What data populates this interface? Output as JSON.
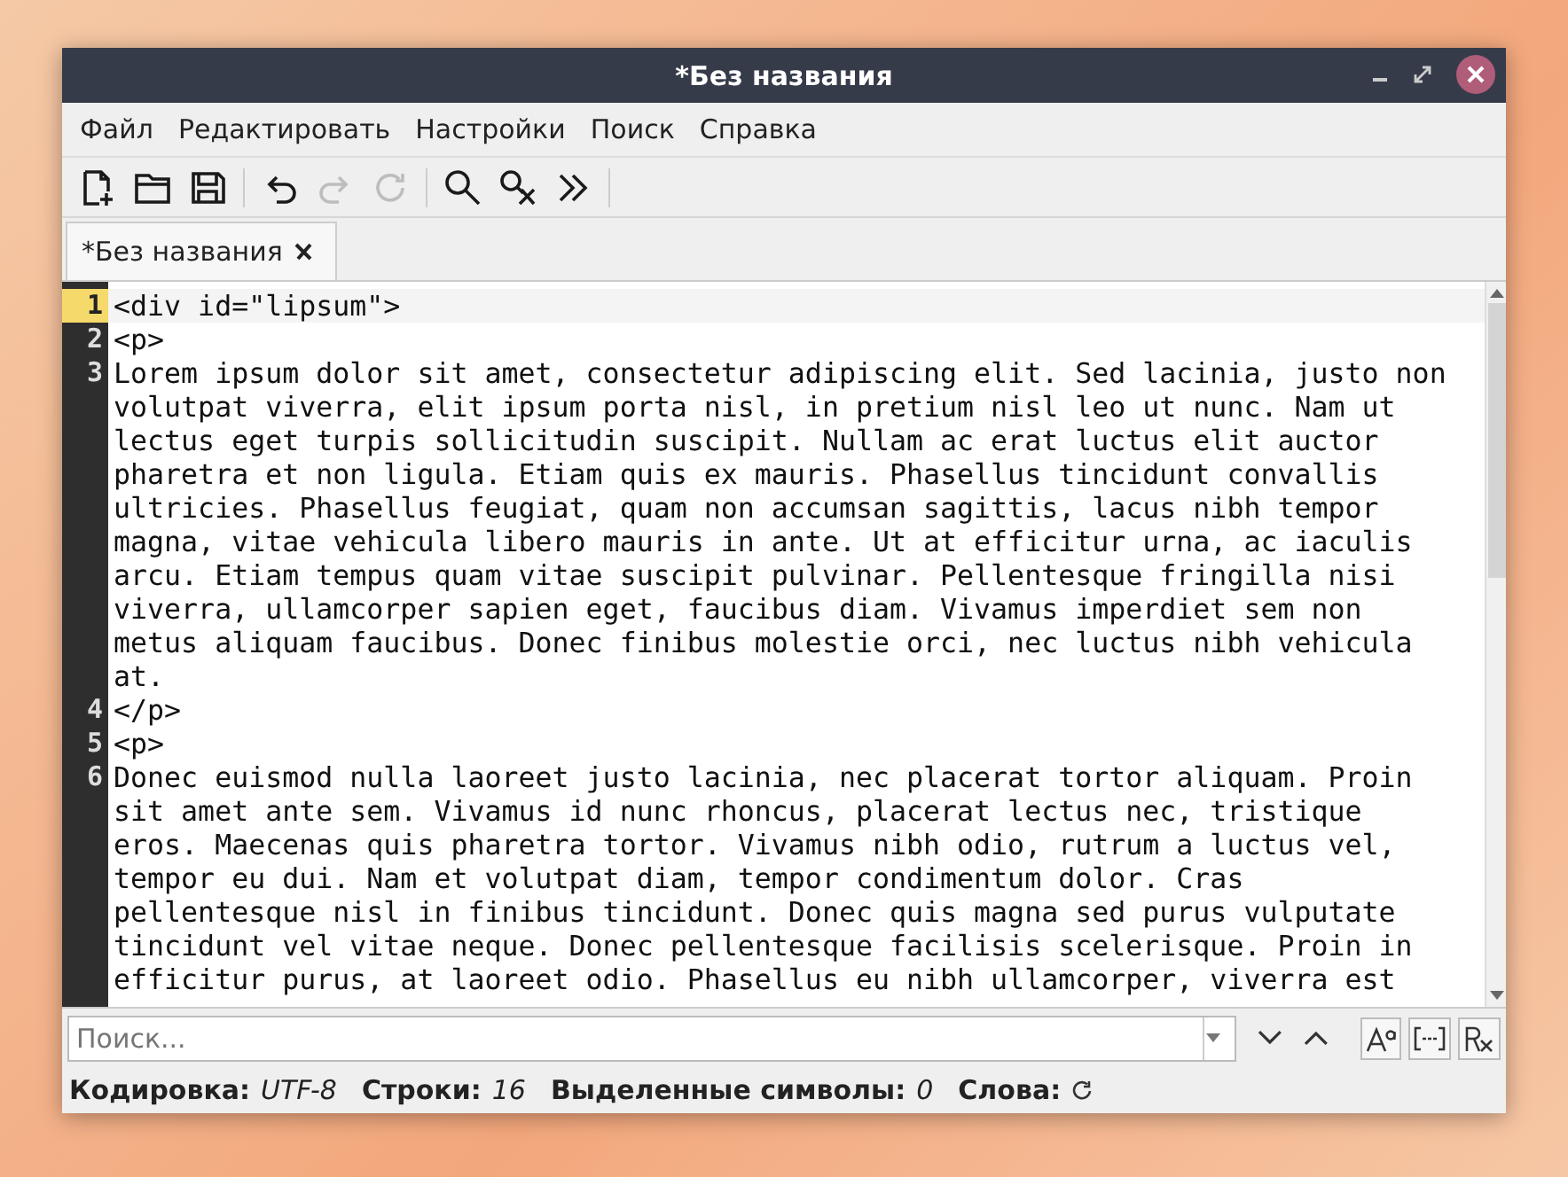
{
  "window": {
    "title": "*Без названия"
  },
  "menu": [
    "Файл",
    "Редактировать",
    "Настройки",
    "Поиск",
    "Справка"
  ],
  "toolbar": [
    {
      "kind": "new",
      "disabled": false
    },
    {
      "kind": "open",
      "disabled": false
    },
    {
      "kind": "save",
      "disabled": false
    },
    {
      "kind": "sep"
    },
    {
      "kind": "undo",
      "disabled": false
    },
    {
      "kind": "redo",
      "disabled": true
    },
    {
      "kind": "reload",
      "disabled": true
    },
    {
      "kind": "sep"
    },
    {
      "kind": "find",
      "disabled": false
    },
    {
      "kind": "replace",
      "disabled": false
    },
    {
      "kind": "more",
      "disabled": false
    }
  ],
  "tabs": [
    {
      "label": "*Без названия",
      "selected": true
    }
  ],
  "editor": {
    "lines": [
      {
        "number": "1",
        "current": true,
        "rows": [
          "<div id=\"lipsum\">"
        ]
      },
      {
        "number": "2",
        "current": false,
        "rows": [
          "<p>"
        ]
      },
      {
        "number": "3",
        "current": false,
        "rows": [
          "Lorem ipsum dolor sit amet, consectetur adipiscing elit. Sed lacinia, justo non",
          "volutpat viverra, elit ipsum porta nisl, in pretium nisl leo ut nunc. Nam ut",
          "lectus eget turpis sollicitudin suscipit. Nullam ac erat luctus elit auctor",
          "pharetra et non ligula. Etiam quis ex mauris. Phasellus tincidunt convallis",
          "ultricies. Phasellus feugiat, quam non accumsan sagittis, lacus nibh tempor",
          "magna, vitae vehicula libero mauris in ante. Ut at efficitur urna, ac iaculis",
          "arcu. Etiam tempus quam vitae suscipit pulvinar. Pellentesque fringilla nisi",
          "viverra, ullamcorper sapien eget, faucibus diam. Vivamus imperdiet sem non",
          "metus aliquam faucibus. Donec finibus molestie orci, nec luctus nibh vehicula",
          "at."
        ]
      },
      {
        "number": "4",
        "current": false,
        "rows": [
          "</p>"
        ]
      },
      {
        "number": "5",
        "current": false,
        "rows": [
          "<p>"
        ]
      },
      {
        "number": "6",
        "current": false,
        "rows": [
          "Donec euismod nulla laoreet justo lacinia, nec placerat tortor aliquam. Proin",
          "sit amet ante sem. Vivamus id nunc rhoncus, placerat lectus nec, tristique",
          "eros. Maecenas quis pharetra tortor. Vivamus nibh odio, rutrum a luctus vel,",
          "tempor eu dui. Nam et volutpat diam, tempor condimentum dolor. Cras",
          "pellentesque nisl in finibus tincidunt. Donec quis magna sed purus vulputate",
          "tincidunt vel vitae neque. Donec pellentesque facilisis scelerisque. Proin in",
          "efficitur purus, at laoreet odio. Phasellus eu nibh ullamcorper, viverra est"
        ]
      }
    ]
  },
  "search": {
    "placeholder": "Поиск...",
    "match_case": false,
    "whole_word": false,
    "regex": false
  },
  "status_bar": [
    {
      "label": "Кодировка:",
      "value": "UTF-8"
    },
    {
      "label": "Строки:",
      "value": "16"
    },
    {
      "label": "Выделенные символы:",
      "value": "0"
    },
    {
      "label": "Слова:"
    }
  ]
}
